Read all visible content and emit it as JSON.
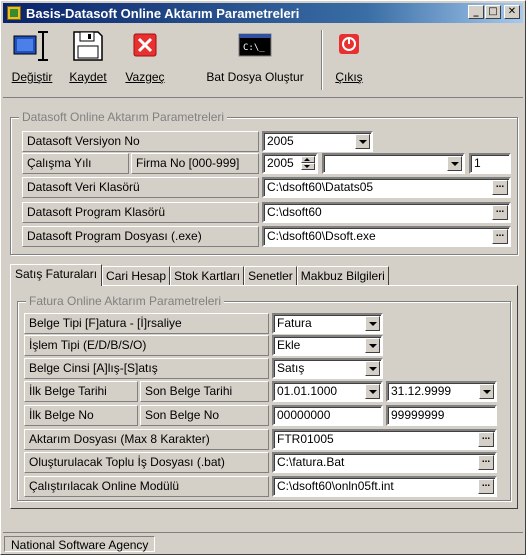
{
  "window": {
    "title": "Basis-Datasoft Online Aktarım Parametreleri",
    "min_label": "_",
    "max_label": "□",
    "close_label": "✕"
  },
  "toolbar": {
    "degistir": "Değiştir",
    "kaydet": "Kaydet",
    "vazgec": "Vazgeç",
    "bat": "Bat Dosya Oluştur",
    "cikis": "Çıkış",
    "cmd_text": "C:\\_"
  },
  "datasoft": {
    "group_title": "Datasoft Online Aktarım Parametreleri",
    "versiyon_label": "Datasoft Versiyon No",
    "versiyon_value": "2005",
    "calisma_yili_label": "Çalışma Yılı",
    "calisma_yili_value": "2005",
    "firma_no_label": "Firma No [000-999]",
    "firma_combo_value": "",
    "firma_no_value": "1",
    "veri_klasoru_label": "Datasoft Veri Klasörü",
    "veri_klasoru_value": "C:\\dsoft60\\Datats05",
    "program_klasoru_label": "Datasoft Program Klasörü",
    "program_klasoru_value": "C:\\dsoft60",
    "program_dosyasi_label": "Datasoft Program Dosyası (.exe)",
    "program_dosyasi_value": "C:\\dsoft60\\Dsoft.exe"
  },
  "tabs": [
    {
      "label": "Satış Faturaları"
    },
    {
      "label": "Cari Hesap"
    },
    {
      "label": "Stok Kartları"
    },
    {
      "label": "Senetler"
    },
    {
      "label": "Makbuz Bilgileri"
    }
  ],
  "fatura": {
    "group_title": "Fatura Online Aktarım Parametreleri",
    "belge_tipi_label": "Belge Tipi [F]atura - [İ]rsaliye",
    "belge_tipi_value": "Fatura",
    "islem_tipi_label": "İşlem Tipi (E/D/B/S/O)",
    "islem_tipi_value": "Ekle",
    "belge_cinsi_label": "Belge Cinsi [A]lış-[S]atış",
    "belge_cinsi_value": "Satış",
    "ilk_belge_tarihi_label": "İlk Belge Tarihi",
    "son_belge_tarihi_label": "Son Belge Tarihi",
    "ilk_belge_tarihi_value": "01.01.1000",
    "son_belge_tarihi_value": "31.12.9999",
    "ilk_belge_no_label": "İlk Belge No",
    "son_belge_no_label": "Son Belge No",
    "ilk_belge_no_value": "00000000",
    "son_belge_no_value": "99999999",
    "aktarim_dosyasi_label": "Aktarım Dosyası (Max 8 Karakter)",
    "aktarim_dosyasi_value": "FTR01005",
    "toplu_is_label": "Oluşturulacak Toplu İş Dosyası (.bat)",
    "toplu_is_value": "C:\\fatura.Bat",
    "online_modul_label": "Çalıştırılacak Online Modülü",
    "online_modul_value": "C:\\dsoft60\\onln05ft.int",
    "ellipsis": "..."
  },
  "status": {
    "text": "National Software Agency"
  }
}
